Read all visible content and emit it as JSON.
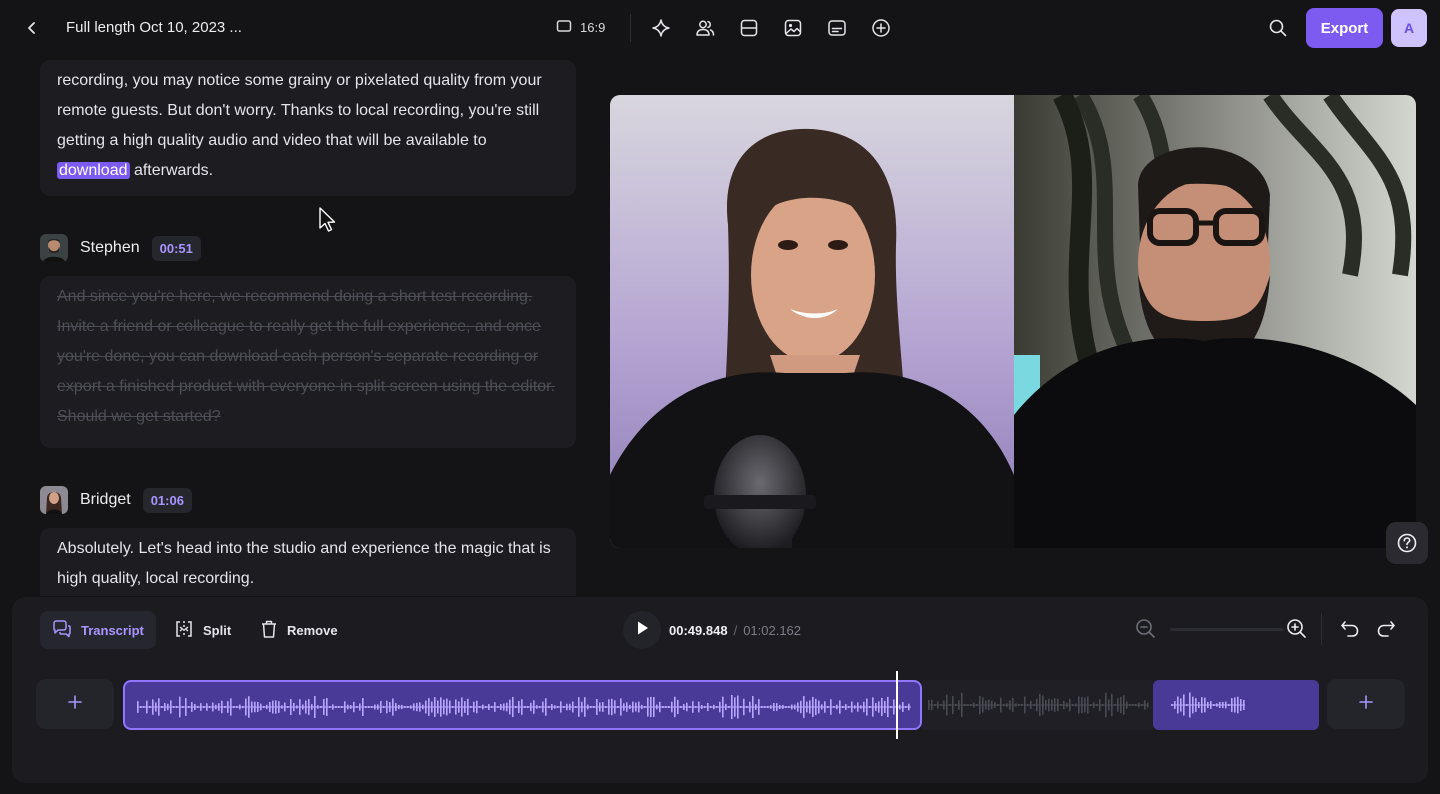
{
  "header": {
    "title": "Full length Oct 10, 2023 ...",
    "aspect_ratio": "16:9",
    "export_label": "Export",
    "avatar_initial": "A",
    "tool_icons": [
      "sparkle-icon",
      "people-icon",
      "layout-icon",
      "image-icon",
      "captions-icon",
      "add-circle-icon"
    ]
  },
  "transcript": {
    "block1": {
      "before": "recording, you may notice some grainy or pixelated quality from your remote guests. But don't worry. Thanks to local recording, you're still getting a high quality audio and video that will be available to ",
      "highlight": "download",
      "after": " afterwards."
    },
    "speaker2": {
      "name": "Stephen",
      "time": "00:51"
    },
    "block2": {
      "text": "And since you're here, we recommend doing a short test recording. Invite a friend or colleague to really get the full experience, and once you're done, you can download each person's separate recording or export a finished product with everyone in split screen using the editor. Should we get started?",
      "struck": true
    },
    "speaker3": {
      "name": "Bridget",
      "time": "01:06"
    },
    "block3": {
      "text": "Absolutely. Let's head into the studio and experience the magic that is high quality, local recording."
    }
  },
  "timeline": {
    "tools": {
      "transcript": "Transcript",
      "split": "Split",
      "remove": "Remove"
    },
    "current_time": "00:49.848",
    "separator": "/",
    "duration": "01:02.162"
  },
  "colors": {
    "accent": "#7c5cf0",
    "accent_light": "#a995ff",
    "background": "#141417",
    "panel": "#1b1b20"
  }
}
